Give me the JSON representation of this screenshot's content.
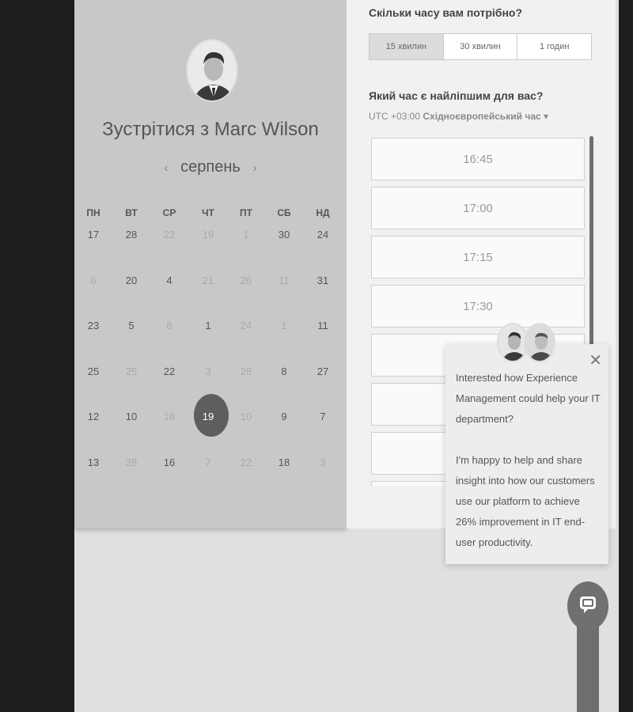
{
  "calendar": {
    "title": "Зустрітися з Marc Wilson",
    "month": "серпень",
    "prev_icon": "‹",
    "next_icon": "›",
    "weekdays": [
      "ПН",
      "ВТ",
      "СР",
      "ЧТ",
      "ПТ",
      "СБ",
      "НД"
    ],
    "weeks": [
      [
        "17",
        "28",
        "22",
        "19",
        "1",
        "30",
        "24"
      ],
      [
        "6",
        "20",
        "4",
        "21",
        "26",
        "11",
        "31"
      ],
      [
        "23",
        "5",
        "8",
        "1",
        "24",
        "1",
        "11"
      ],
      [
        "25",
        "25",
        "22",
        "3",
        "28",
        "8",
        "27"
      ],
      [
        "12",
        "10",
        "18",
        "19",
        "10",
        "9",
        "7"
      ],
      [
        "13",
        "28",
        "16",
        "7",
        "22",
        "18",
        "3"
      ]
    ],
    "selected_day": "19"
  },
  "booking": {
    "duration_question": "Скільки часу вам потрібно?",
    "durations": [
      "15 хвилин",
      "30 хвилин",
      "1 годин"
    ],
    "active_duration": "15 хвилин",
    "time_question": "Який час є найліпшим для вас?",
    "timezone_prefix": "UTC +03:00",
    "timezone_name": "Східноєвропейський час",
    "timezone_caret": "▾",
    "slots": [
      "16:45",
      "17:00",
      "17:15",
      "17:30",
      "",
      "",
      "",
      ""
    ]
  },
  "popup": {
    "close_icon": "✕",
    "message_line1": "Interested how Experience Management could help your IT department?",
    "message_line2": "I'm happy to help and share insight into how our customers use our platform to achieve 26% improvement in IT end-user productivity."
  },
  "chat": {
    "icon": "chat-bubble-icon"
  }
}
